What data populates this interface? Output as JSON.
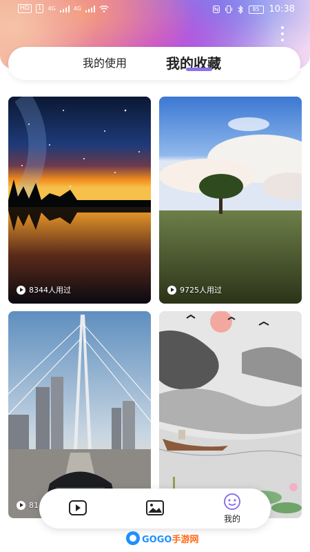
{
  "status_bar": {
    "left_chips": [
      "HD",
      "1"
    ],
    "network_labels": [
      "4G",
      "4G"
    ],
    "battery_level": "85",
    "time": "10:38"
  },
  "tabs": [
    {
      "label": "我的使用",
      "active": false
    },
    {
      "label": "我的收藏",
      "active": true
    }
  ],
  "accent_color": "#8d70e8",
  "wallpapers": [
    {
      "usage": "8344人用过",
      "scene": "starry-night-lake"
    },
    {
      "usage": "9725人用过",
      "scene": "lone-tree-meadow"
    },
    {
      "usage": "81",
      "scene": "bridge-city-car"
    },
    {
      "usage": "",
      "scene": "ink-landscape-boat"
    }
  ],
  "bottom_nav": {
    "items": [
      {
        "icon": "video-play-icon",
        "label": "",
        "active": false
      },
      {
        "icon": "image-icon",
        "label": "",
        "active": false
      },
      {
        "icon": "smile-face-icon",
        "label": "我的",
        "active": true
      }
    ]
  },
  "watermark": {
    "part_a": "GOGO",
    "part_b": "手游网"
  }
}
